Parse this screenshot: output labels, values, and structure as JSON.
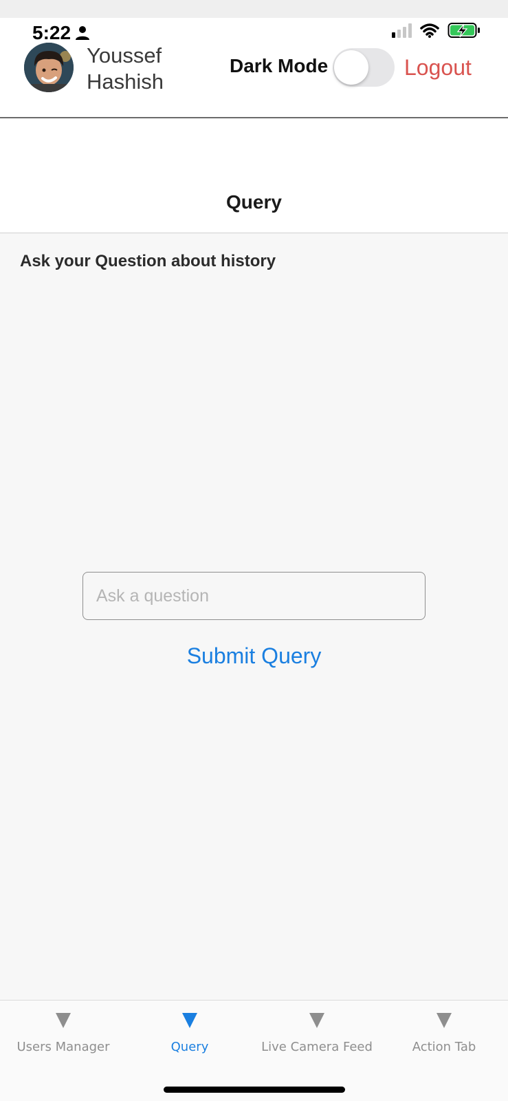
{
  "status_bar": {
    "time": "5:22",
    "icons": [
      "person-icon",
      "cellular-signal-icon",
      "wifi-icon",
      "battery-charging-icon"
    ],
    "battery_color": "#34c759"
  },
  "header": {
    "user_name": "Youssef Hashish",
    "dark_mode_label": "Dark Mode",
    "dark_mode_on": false,
    "logout_label": "Logout"
  },
  "nav": {
    "title": "Query"
  },
  "main": {
    "prompt": "Ask your Question about history",
    "input_placeholder": "Ask a question",
    "input_value": "",
    "submit_label": "Submit Query"
  },
  "tabs": [
    {
      "label": "Users Manager",
      "active": false
    },
    {
      "label": "Query",
      "active": true
    },
    {
      "label": "Live Camera Feed",
      "active": false
    },
    {
      "label": "Action Tab",
      "active": false
    }
  ],
  "colors": {
    "accent": "#1a7fe0",
    "logout": "#d9534f",
    "inactive_tab": "#8e8e8e"
  }
}
